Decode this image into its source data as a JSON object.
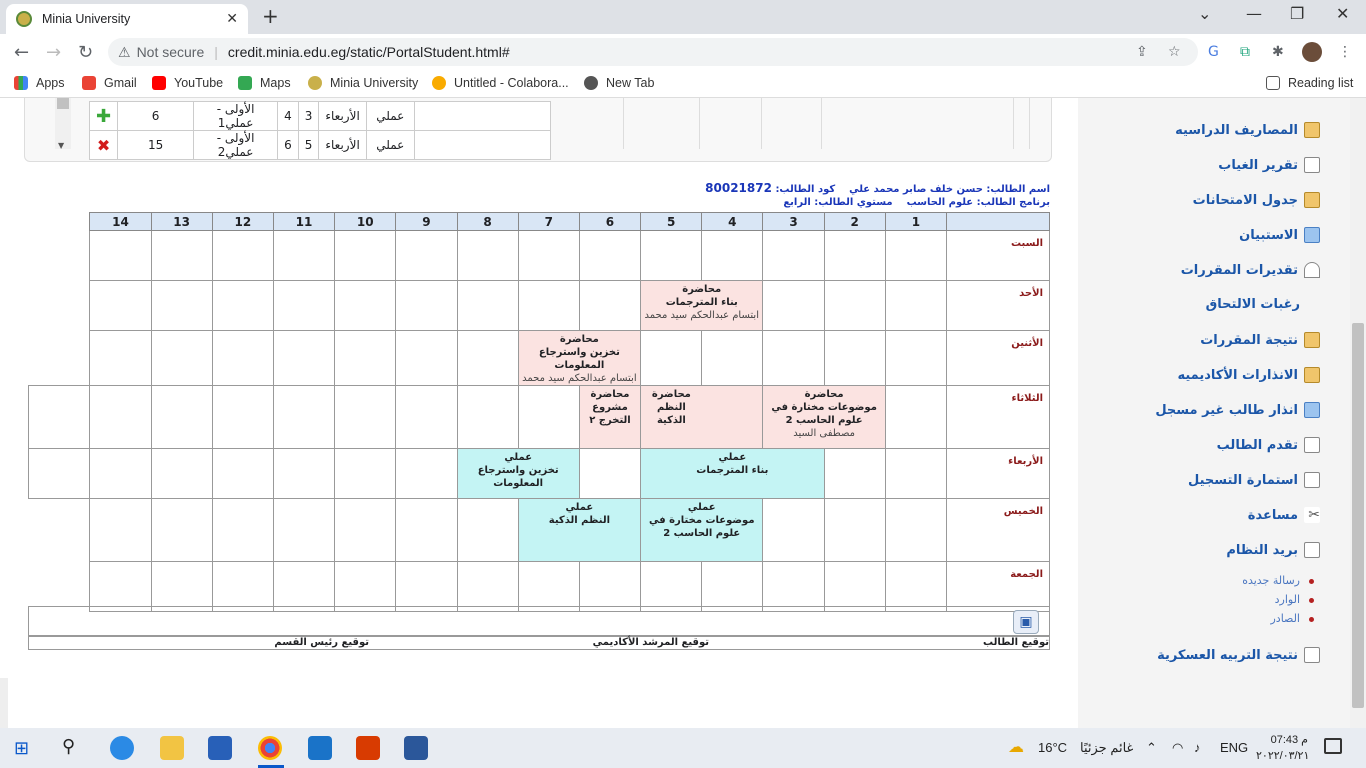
{
  "browser": {
    "tab_title": "Minia University",
    "not_secure": "Not secure",
    "url": "credit.minia.edu.eg/static/PortalStudent.html#",
    "bookmarks": [
      "Apps",
      "Gmail",
      "YouTube",
      "Maps",
      "Minia University",
      "Untitled - Colabora...",
      "New Tab"
    ],
    "reading_list": "Reading list"
  },
  "top_table": {
    "rows": [
      {
        "type": "عملي",
        "day": "الأربعاء",
        "n1": "3",
        "n2": "4",
        "group": "الأولى - عملي1",
        "count": "6",
        "action": "add"
      },
      {
        "type": "عملي",
        "day": "الأربعاء",
        "n1": "5",
        "n2": "6",
        "group": "الأولى - عملي2",
        "count": "15",
        "action": "remove"
      }
    ]
  },
  "student": {
    "name_label": "اسم الطالب:",
    "name": "حسن خلف صابر محمد علي",
    "code_label": "كود الطالب:",
    "code": "80021872",
    "program_label": "برنامج الطالب:",
    "program": "علوم الحاسب",
    "level_label": "مستوي الطالب:",
    "level": "الرابع"
  },
  "schedule": {
    "periods": [
      "1",
      "2",
      "3",
      "4",
      "5",
      "6",
      "7",
      "8",
      "9",
      "10",
      "11",
      "12",
      "13",
      "14"
    ],
    "days": [
      "السبت",
      "الأحد",
      "الأثنين",
      "الثلاثاء",
      "الأربعاء",
      "الخميس",
      "الجمعة"
    ],
    "sessions": {
      "sun_4": {
        "kind": "محاضرة",
        "course": "بناء المترجمات",
        "teacher": "ابتسام عبدالحكم سيد محمد"
      },
      "mon_6": {
        "kind": "محاضرة",
        "course": "تخزين واسترجاع المعلومات",
        "teacher": "ابتسام عبدالحكم سيد محمد"
      },
      "tue_2": {
        "kind": "محاضرة",
        "course": "موضوعات مختارة في علوم الحاسب 2",
        "teacher": "مصطفى السيد"
      },
      "tue_4": {
        "kind": "محاضرة",
        "course": "النظم الذكية"
      },
      "tue_5": {
        "kind": "محاضرة",
        "course": "مشروع التخرج ٢"
      },
      "wed_3": {
        "kind": "عملي",
        "course": "بناء المترجمات"
      },
      "wed_5": {
        "kind": "عملي",
        "course": "تخزين واسترجاع المعلومات"
      },
      "thu_4": {
        "kind": "عملي",
        "course": "موضوعات مختارة في علوم الحاسب 2"
      },
      "thu_5": {
        "kind": "عملي",
        "course": "النظم الذكية"
      }
    },
    "sign_student": "توقيع الطالب",
    "sign_advisor": "توقيع المرشد الأكاديمي",
    "sign_head": "توقيع رئيس القسم"
  },
  "sidebar": {
    "items": [
      "المصاريف الدراسيه",
      "تقرير الغياب",
      "جدول الامتحانات",
      "الاستبيان",
      "تقديرات المقررات",
      "رغبات الالتحاق",
      "نتيجة المقررات",
      "الانذارات الأكاديميه",
      "انذار طالب غير مسجل",
      "تقدم الطالب",
      "استمارة التسجيل",
      "مساعدة",
      "بريد النظام"
    ],
    "mail_sub": [
      "رسالة جديده",
      "الوارد",
      "الصادر"
    ],
    "last_item": "نتيجة التربيه العسكرية"
  },
  "taskbar": {
    "temp": "16°C",
    "weather": "غائم جزئيًا",
    "lang": "ENG",
    "time": "م 07:43",
    "date": "٢٠٢٢/٠٣/٢١"
  }
}
